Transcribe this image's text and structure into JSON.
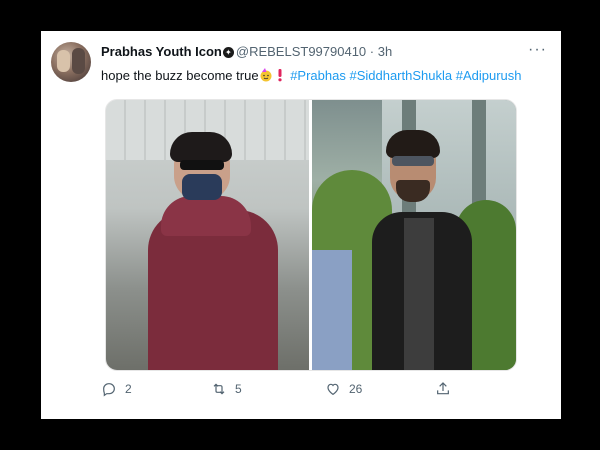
{
  "tweet": {
    "author_name": "Prabhas Youth Icon",
    "handle": "@REBELST99790410",
    "dot": "·",
    "time": "3h",
    "more_icon": "more-icon",
    "text_plain": "hope the buzz become true",
    "hashtags": [
      "#Prabhas",
      "#SiddharthShukla",
      "#Adipurush"
    ],
    "emojis": [
      "party-face-icon",
      "exclamation-icon"
    ]
  },
  "actions": {
    "reply_count": "2",
    "retweet_count": "5",
    "like_count": "26"
  },
  "colors": {
    "link": "#1d9bf0",
    "secondary_text": "#536471",
    "primary_text": "#0f1419",
    "background": "#000000",
    "card": "#ffffff"
  }
}
